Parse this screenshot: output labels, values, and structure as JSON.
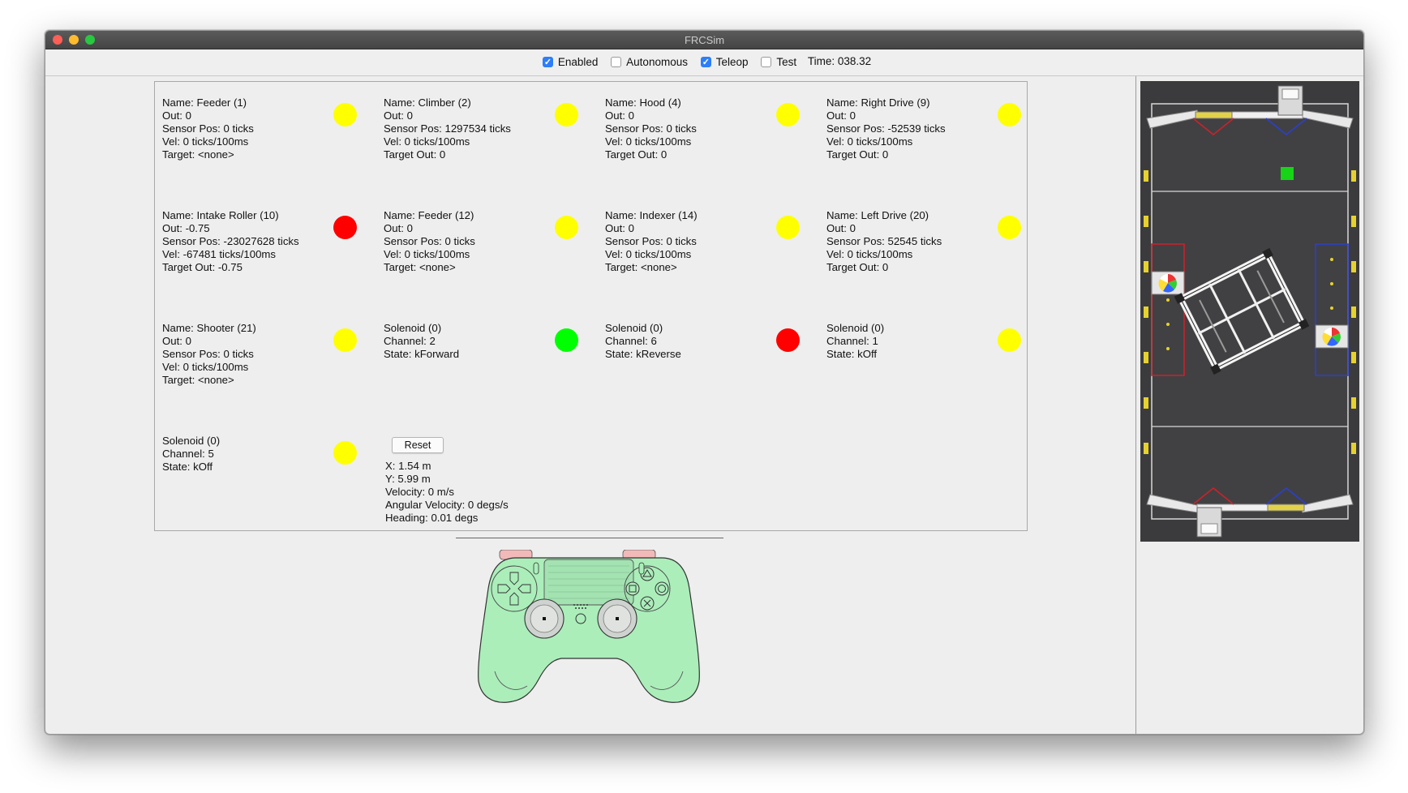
{
  "window": {
    "title": "FRCSim"
  },
  "toolbar": {
    "modes": [
      {
        "label": "Enabled",
        "checked": true
      },
      {
        "label": "Autonomous",
        "checked": false
      },
      {
        "label": "Teleop",
        "checked": true
      },
      {
        "label": "Test",
        "checked": false
      }
    ],
    "time_label": "Time: 038.32"
  },
  "devices": [
    {
      "lines": [
        "Name: Feeder (1)",
        "Out: 0",
        "Sensor Pos: 0 ticks",
        "Vel: 0 ticks/100ms",
        "Target: <none>"
      ],
      "status": "yellow"
    },
    {
      "lines": [
        "Name: Climber (2)",
        "Out: 0",
        "Sensor Pos: 1297534 ticks",
        "Vel: 0 ticks/100ms",
        "Target Out: 0"
      ],
      "status": "yellow"
    },
    {
      "lines": [
        "Name: Hood (4)",
        "Out: 0",
        "Sensor Pos: 0 ticks",
        "Vel: 0 ticks/100ms",
        "Target Out: 0"
      ],
      "status": "yellow"
    },
    {
      "lines": [
        "Name: Right Drive (9)",
        "Out: 0",
        "Sensor Pos: -52539 ticks",
        "Vel: 0 ticks/100ms",
        "Target Out: 0"
      ],
      "status": "yellow"
    },
    {
      "lines": [
        "Name: Intake Roller (10)",
        "Out: -0.75",
        "Sensor Pos: -23027628 ticks",
        "Vel: -67481 ticks/100ms",
        "Target Out: -0.75"
      ],
      "status": "red"
    },
    {
      "lines": [
        "Name: Feeder (12)",
        "Out: 0",
        "Sensor Pos: 0 ticks",
        "Vel: 0 ticks/100ms",
        "Target: <none>"
      ],
      "status": "yellow"
    },
    {
      "lines": [
        "Name: Indexer (14)",
        "Out: 0",
        "Sensor Pos: 0 ticks",
        "Vel: 0 ticks/100ms",
        "Target: <none>"
      ],
      "status": "yellow"
    },
    {
      "lines": [
        "Name: Left Drive (20)",
        "Out: 0",
        "Sensor Pos: 52545 ticks",
        "Vel: 0 ticks/100ms",
        "Target Out: 0"
      ],
      "status": "yellow"
    },
    {
      "lines": [
        "Name: Shooter (21)",
        "Out: 0",
        "Sensor Pos: 0 ticks",
        "Vel: 0 ticks/100ms",
        "Target: <none>"
      ],
      "status": "yellow"
    },
    {
      "lines": [
        "Solenoid (0)",
        "Channel: 2",
        "State: kForward"
      ],
      "status": "green"
    },
    {
      "lines": [
        "Solenoid (0)",
        "Channel: 6",
        "State: kReverse"
      ],
      "status": "red"
    },
    {
      "lines": [
        "Solenoid (0)",
        "Channel: 1",
        "State: kOff"
      ],
      "status": "yellow"
    },
    {
      "lines": [
        "Solenoid (0)",
        "Channel: 5",
        "State: kOff"
      ],
      "status": "yellow"
    }
  ],
  "robot": {
    "reset_label": "Reset",
    "pose_lines": [
      "X: 1.54 m",
      "Y: 5.99 m",
      "Velocity: 0 m/s",
      "Angular Velocity: 0 degs/s",
      "Heading: 0.01 degs"
    ]
  },
  "colors": {
    "yellow": "#ffff00",
    "red": "#ff0000",
    "green": "#00ff00",
    "controller": "#abeeba",
    "field_carpet": "#3b3b3d",
    "red_alliance": "#d0202a",
    "blue_alliance": "#2a3fd6"
  },
  "controller": {
    "icon": "gamepad-icon"
  },
  "field": {
    "icon": "field-map"
  }
}
